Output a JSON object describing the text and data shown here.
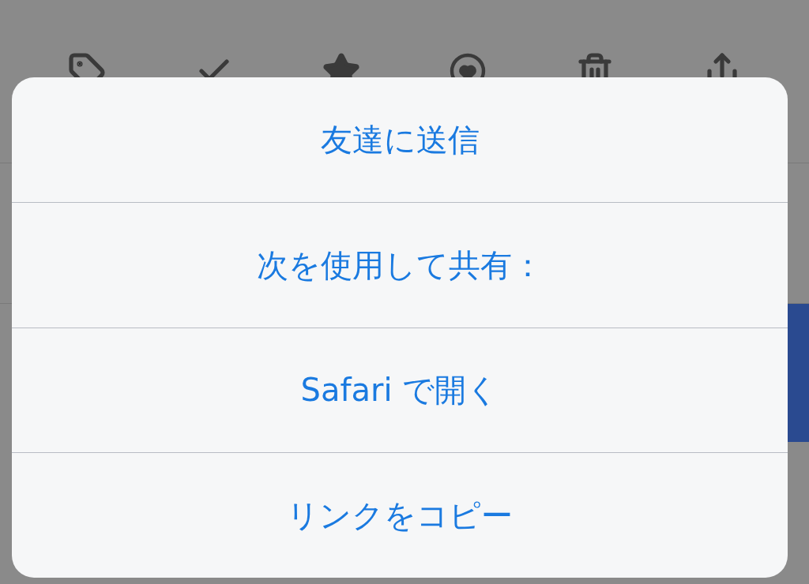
{
  "action_sheet": {
    "actions": [
      {
        "label": "友達に送信"
      },
      {
        "label": "次を使用して共有："
      },
      {
        "label": "Safari で開く"
      },
      {
        "label": "リンクをコピー"
      }
    ]
  }
}
